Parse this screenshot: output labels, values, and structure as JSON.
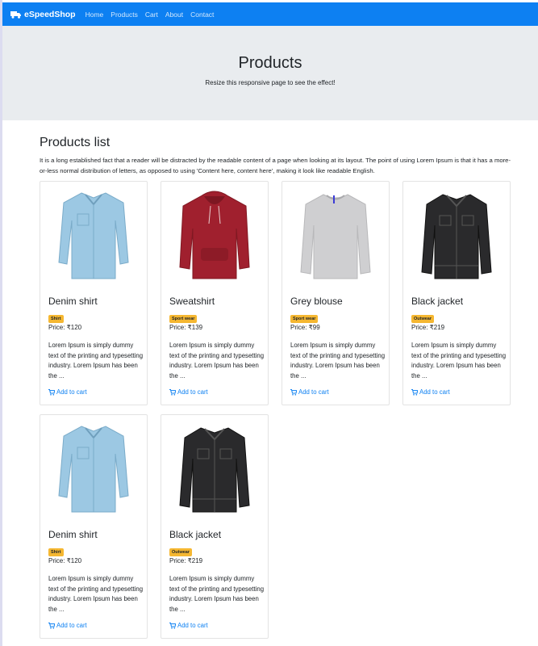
{
  "navbar": {
    "brand": "eSpeedShop",
    "links": [
      "Home",
      "Products",
      "Cart",
      "About",
      "Contact"
    ]
  },
  "jumbotron": {
    "title": "Products",
    "subtitle": "Resize this responsive page to see the effect!"
  },
  "section": {
    "title": "Products list",
    "description": "It is a long established fact that a reader will be distracted by the readable content of a page when looking at its layout. The point of using Lorem Ipsum is that it has a more-or-less normal distribution of letters, as opposed to using 'Content here, content here', making it look like readable English."
  },
  "products": [
    {
      "name": "Denim shirt",
      "category": "Shirt",
      "price": "Price: ₹120",
      "description": "Lorem Ipsum is simply dummy text of the printing and typesetting industry. Lorem Ipsum has been the ...",
      "cart_label": "Add to cart",
      "image": "denim-shirt"
    },
    {
      "name": "Sweatshirt",
      "category": "Sport wear",
      "price": "Price: ₹139",
      "description": "Lorem Ipsum is simply dummy text of the printing and typesetting industry. Lorem Ipsum has been the ...",
      "cart_label": "Add to cart",
      "image": "red-hoodie"
    },
    {
      "name": "Grey blouse",
      "category": "Sport wear",
      "price": "Price: ₹99",
      "description": "Lorem Ipsum is simply dummy text of the printing and typesetting industry. Lorem Ipsum has been the ...",
      "cart_label": "Add to cart",
      "image": "grey-sweater"
    },
    {
      "name": "Black jacket",
      "category": "Outwear",
      "price": "Price: ₹219",
      "description": "Lorem Ipsum is simply dummy text of the printing and typesetting industry. Lorem Ipsum has been the ...",
      "cart_label": "Add to cart",
      "image": "black-jacket"
    },
    {
      "name": "Denim shirt",
      "category": "Shirt",
      "price": "Price: ₹120",
      "description": "Lorem Ipsum is simply dummy text of the printing and typesetting industry. Lorem Ipsum has been the ...",
      "cart_label": "Add to cart",
      "image": "denim-shirt"
    },
    {
      "name": "Black jacket",
      "category": "Outwear",
      "price": "Price: ₹219",
      "description": "Lorem Ipsum is simply dummy text of the printing and typesetting industry. Lorem Ipsum has been the ...",
      "cart_label": "Add to cart",
      "image": "black-jacket"
    }
  ],
  "colors": {
    "navbar": "#0d80f2",
    "jumbotron": "#e9ecef",
    "badge": "#f5b731",
    "link": "#0d80f2"
  }
}
